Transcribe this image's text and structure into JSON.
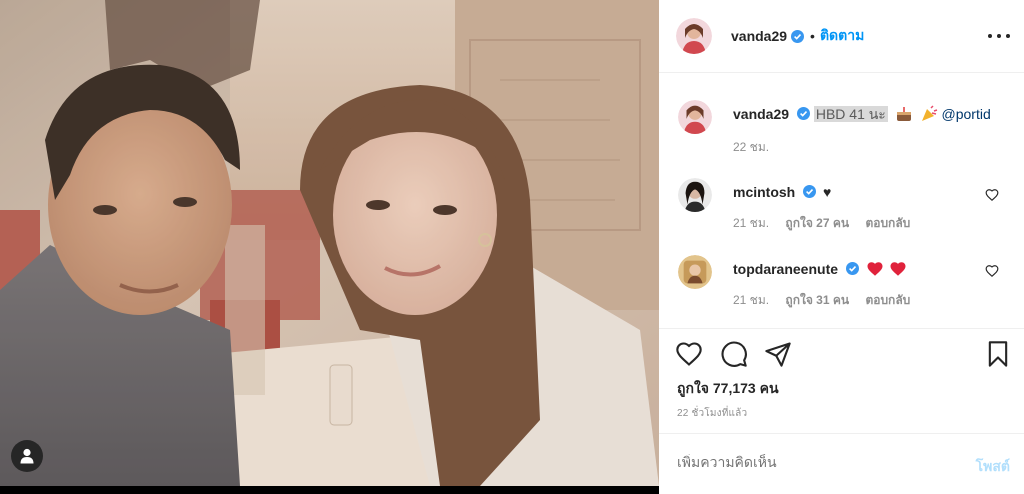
{
  "post": {
    "author": "vanda29",
    "follow_label": "ติดตาม",
    "separator": "•",
    "photo_description": "Selfie of a man and a woman smiling in a restaurant"
  },
  "caption": {
    "username": "vanda29",
    "text": "HBD 41 นะ",
    "mention": "@portid",
    "time": "22 ชม."
  },
  "comments": [
    {
      "username": "mcintosh",
      "text": "♥",
      "time": "21 ชม.",
      "likes": "ถูกใจ 27 คน",
      "reply": "ตอบกลับ"
    },
    {
      "username": "topdaraneenute",
      "text": "",
      "time": "21 ชม.",
      "likes": "ถูกใจ 31 คน",
      "reply": "ตอบกลับ"
    }
  ],
  "stats": {
    "likes": "ถูกใจ 77,173 คน",
    "posted": "22 ชั่วโมงที่แล้ว"
  },
  "composer": {
    "placeholder": "เพิ่มความคิดเห็น",
    "post_label": "โพสต์"
  },
  "colors": {
    "accent": "#0095f6",
    "verified": "#3897f0",
    "heart": "#ed4956",
    "muted": "#8e8e8e"
  },
  "icons": [
    "user-tag-icon",
    "verified-icon",
    "more-options-icon",
    "heart-icon",
    "comment-icon",
    "share-icon",
    "bookmark-icon",
    "cake-icon",
    "party-popper-icon"
  ]
}
